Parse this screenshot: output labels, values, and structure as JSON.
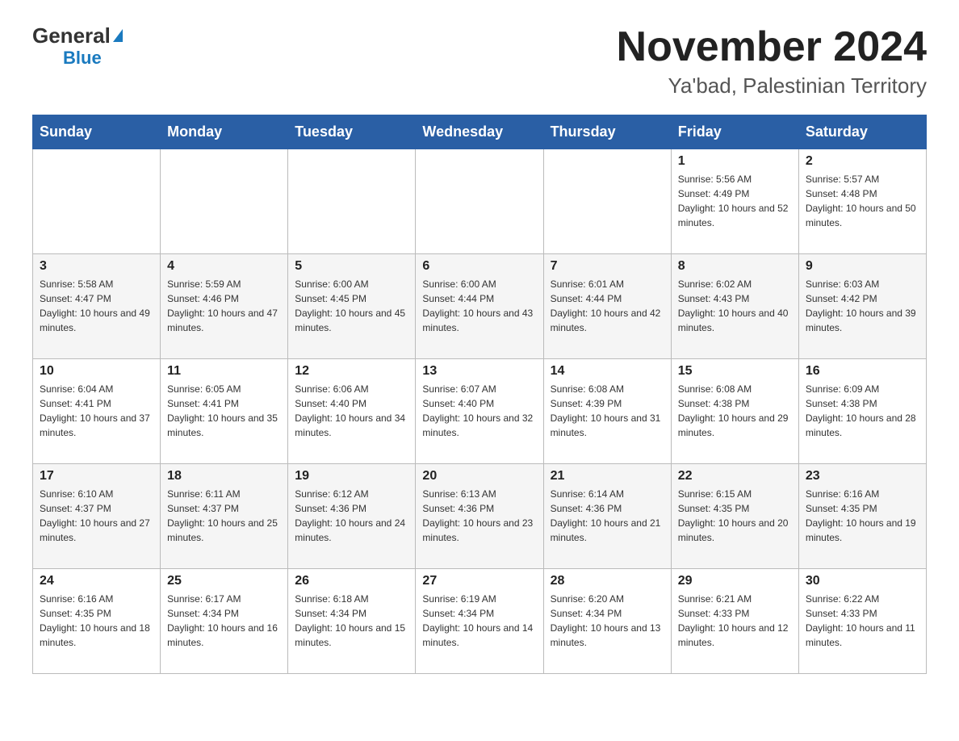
{
  "logo": {
    "general": "General",
    "triangle": "▶",
    "blue": "Blue"
  },
  "title": "November 2024",
  "subtitle": "Ya'bad, Palestinian Territory",
  "weekdays": [
    "Sunday",
    "Monday",
    "Tuesday",
    "Wednesday",
    "Thursday",
    "Friday",
    "Saturday"
  ],
  "weeks": [
    [
      {
        "day": "",
        "info": ""
      },
      {
        "day": "",
        "info": ""
      },
      {
        "day": "",
        "info": ""
      },
      {
        "day": "",
        "info": ""
      },
      {
        "day": "",
        "info": ""
      },
      {
        "day": "1",
        "info": "Sunrise: 5:56 AM\nSunset: 4:49 PM\nDaylight: 10 hours and 52 minutes."
      },
      {
        "day": "2",
        "info": "Sunrise: 5:57 AM\nSunset: 4:48 PM\nDaylight: 10 hours and 50 minutes."
      }
    ],
    [
      {
        "day": "3",
        "info": "Sunrise: 5:58 AM\nSunset: 4:47 PM\nDaylight: 10 hours and 49 minutes."
      },
      {
        "day": "4",
        "info": "Sunrise: 5:59 AM\nSunset: 4:46 PM\nDaylight: 10 hours and 47 minutes."
      },
      {
        "day": "5",
        "info": "Sunrise: 6:00 AM\nSunset: 4:45 PM\nDaylight: 10 hours and 45 minutes."
      },
      {
        "day": "6",
        "info": "Sunrise: 6:00 AM\nSunset: 4:44 PM\nDaylight: 10 hours and 43 minutes."
      },
      {
        "day": "7",
        "info": "Sunrise: 6:01 AM\nSunset: 4:44 PM\nDaylight: 10 hours and 42 minutes."
      },
      {
        "day": "8",
        "info": "Sunrise: 6:02 AM\nSunset: 4:43 PM\nDaylight: 10 hours and 40 minutes."
      },
      {
        "day": "9",
        "info": "Sunrise: 6:03 AM\nSunset: 4:42 PM\nDaylight: 10 hours and 39 minutes."
      }
    ],
    [
      {
        "day": "10",
        "info": "Sunrise: 6:04 AM\nSunset: 4:41 PM\nDaylight: 10 hours and 37 minutes."
      },
      {
        "day": "11",
        "info": "Sunrise: 6:05 AM\nSunset: 4:41 PM\nDaylight: 10 hours and 35 minutes."
      },
      {
        "day": "12",
        "info": "Sunrise: 6:06 AM\nSunset: 4:40 PM\nDaylight: 10 hours and 34 minutes."
      },
      {
        "day": "13",
        "info": "Sunrise: 6:07 AM\nSunset: 4:40 PM\nDaylight: 10 hours and 32 minutes."
      },
      {
        "day": "14",
        "info": "Sunrise: 6:08 AM\nSunset: 4:39 PM\nDaylight: 10 hours and 31 minutes."
      },
      {
        "day": "15",
        "info": "Sunrise: 6:08 AM\nSunset: 4:38 PM\nDaylight: 10 hours and 29 minutes."
      },
      {
        "day": "16",
        "info": "Sunrise: 6:09 AM\nSunset: 4:38 PM\nDaylight: 10 hours and 28 minutes."
      }
    ],
    [
      {
        "day": "17",
        "info": "Sunrise: 6:10 AM\nSunset: 4:37 PM\nDaylight: 10 hours and 27 minutes."
      },
      {
        "day": "18",
        "info": "Sunrise: 6:11 AM\nSunset: 4:37 PM\nDaylight: 10 hours and 25 minutes."
      },
      {
        "day": "19",
        "info": "Sunrise: 6:12 AM\nSunset: 4:36 PM\nDaylight: 10 hours and 24 minutes."
      },
      {
        "day": "20",
        "info": "Sunrise: 6:13 AM\nSunset: 4:36 PM\nDaylight: 10 hours and 23 minutes."
      },
      {
        "day": "21",
        "info": "Sunrise: 6:14 AM\nSunset: 4:36 PM\nDaylight: 10 hours and 21 minutes."
      },
      {
        "day": "22",
        "info": "Sunrise: 6:15 AM\nSunset: 4:35 PM\nDaylight: 10 hours and 20 minutes."
      },
      {
        "day": "23",
        "info": "Sunrise: 6:16 AM\nSunset: 4:35 PM\nDaylight: 10 hours and 19 minutes."
      }
    ],
    [
      {
        "day": "24",
        "info": "Sunrise: 6:16 AM\nSunset: 4:35 PM\nDaylight: 10 hours and 18 minutes."
      },
      {
        "day": "25",
        "info": "Sunrise: 6:17 AM\nSunset: 4:34 PM\nDaylight: 10 hours and 16 minutes."
      },
      {
        "day": "26",
        "info": "Sunrise: 6:18 AM\nSunset: 4:34 PM\nDaylight: 10 hours and 15 minutes."
      },
      {
        "day": "27",
        "info": "Sunrise: 6:19 AM\nSunset: 4:34 PM\nDaylight: 10 hours and 14 minutes."
      },
      {
        "day": "28",
        "info": "Sunrise: 6:20 AM\nSunset: 4:34 PM\nDaylight: 10 hours and 13 minutes."
      },
      {
        "day": "29",
        "info": "Sunrise: 6:21 AM\nSunset: 4:33 PM\nDaylight: 10 hours and 12 minutes."
      },
      {
        "day": "30",
        "info": "Sunrise: 6:22 AM\nSunset: 4:33 PM\nDaylight: 10 hours and 11 minutes."
      }
    ]
  ]
}
